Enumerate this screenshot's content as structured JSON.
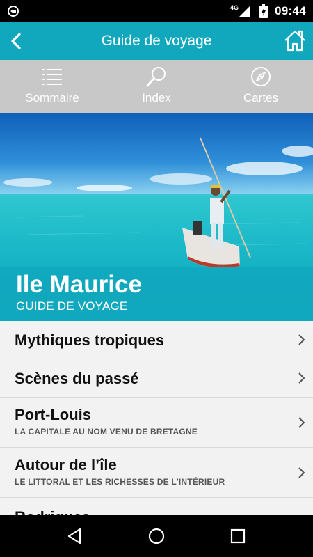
{
  "status_bar": {
    "network_type": "4G",
    "time": "09:44",
    "icons": [
      "notification-icon",
      "signal-icon",
      "battery-charging-icon"
    ]
  },
  "app_bar": {
    "title": "Guide de voyage",
    "back_icon": "back-arrow-icon",
    "home_icon": "home-icon"
  },
  "toolbar": {
    "items": [
      {
        "label": "Sommaire",
        "icon": "list-icon"
      },
      {
        "label": "Index",
        "icon": "magnifier-icon"
      },
      {
        "label": "Cartes",
        "icon": "compass-icon"
      }
    ]
  },
  "hero": {
    "title": "Ile Maurice",
    "subtitle": "GUIDE DE VOYAGE"
  },
  "toc": {
    "items": [
      {
        "title": "Mythiques tropiques",
        "subtitle": ""
      },
      {
        "title": "Scènes du passé",
        "subtitle": ""
      },
      {
        "title": "Port-Louis",
        "subtitle": "LA CAPITALE AU NOM VENU DE BRETAGNE"
      },
      {
        "title": "Autour de l’île",
        "subtitle": "LE LITTORAL ET LES RICHESSES DE L'INTÉRIEUR"
      },
      {
        "title": "Rodrigues",
        "subtitle": ""
      }
    ]
  },
  "colors": {
    "accent": "#11a8be",
    "toolbar_bg": "#c8c8c8",
    "list_bg": "#f2f2f2"
  },
  "nav_bar": {
    "icons": [
      "nav-back-icon",
      "nav-home-icon",
      "nav-recents-icon"
    ]
  }
}
